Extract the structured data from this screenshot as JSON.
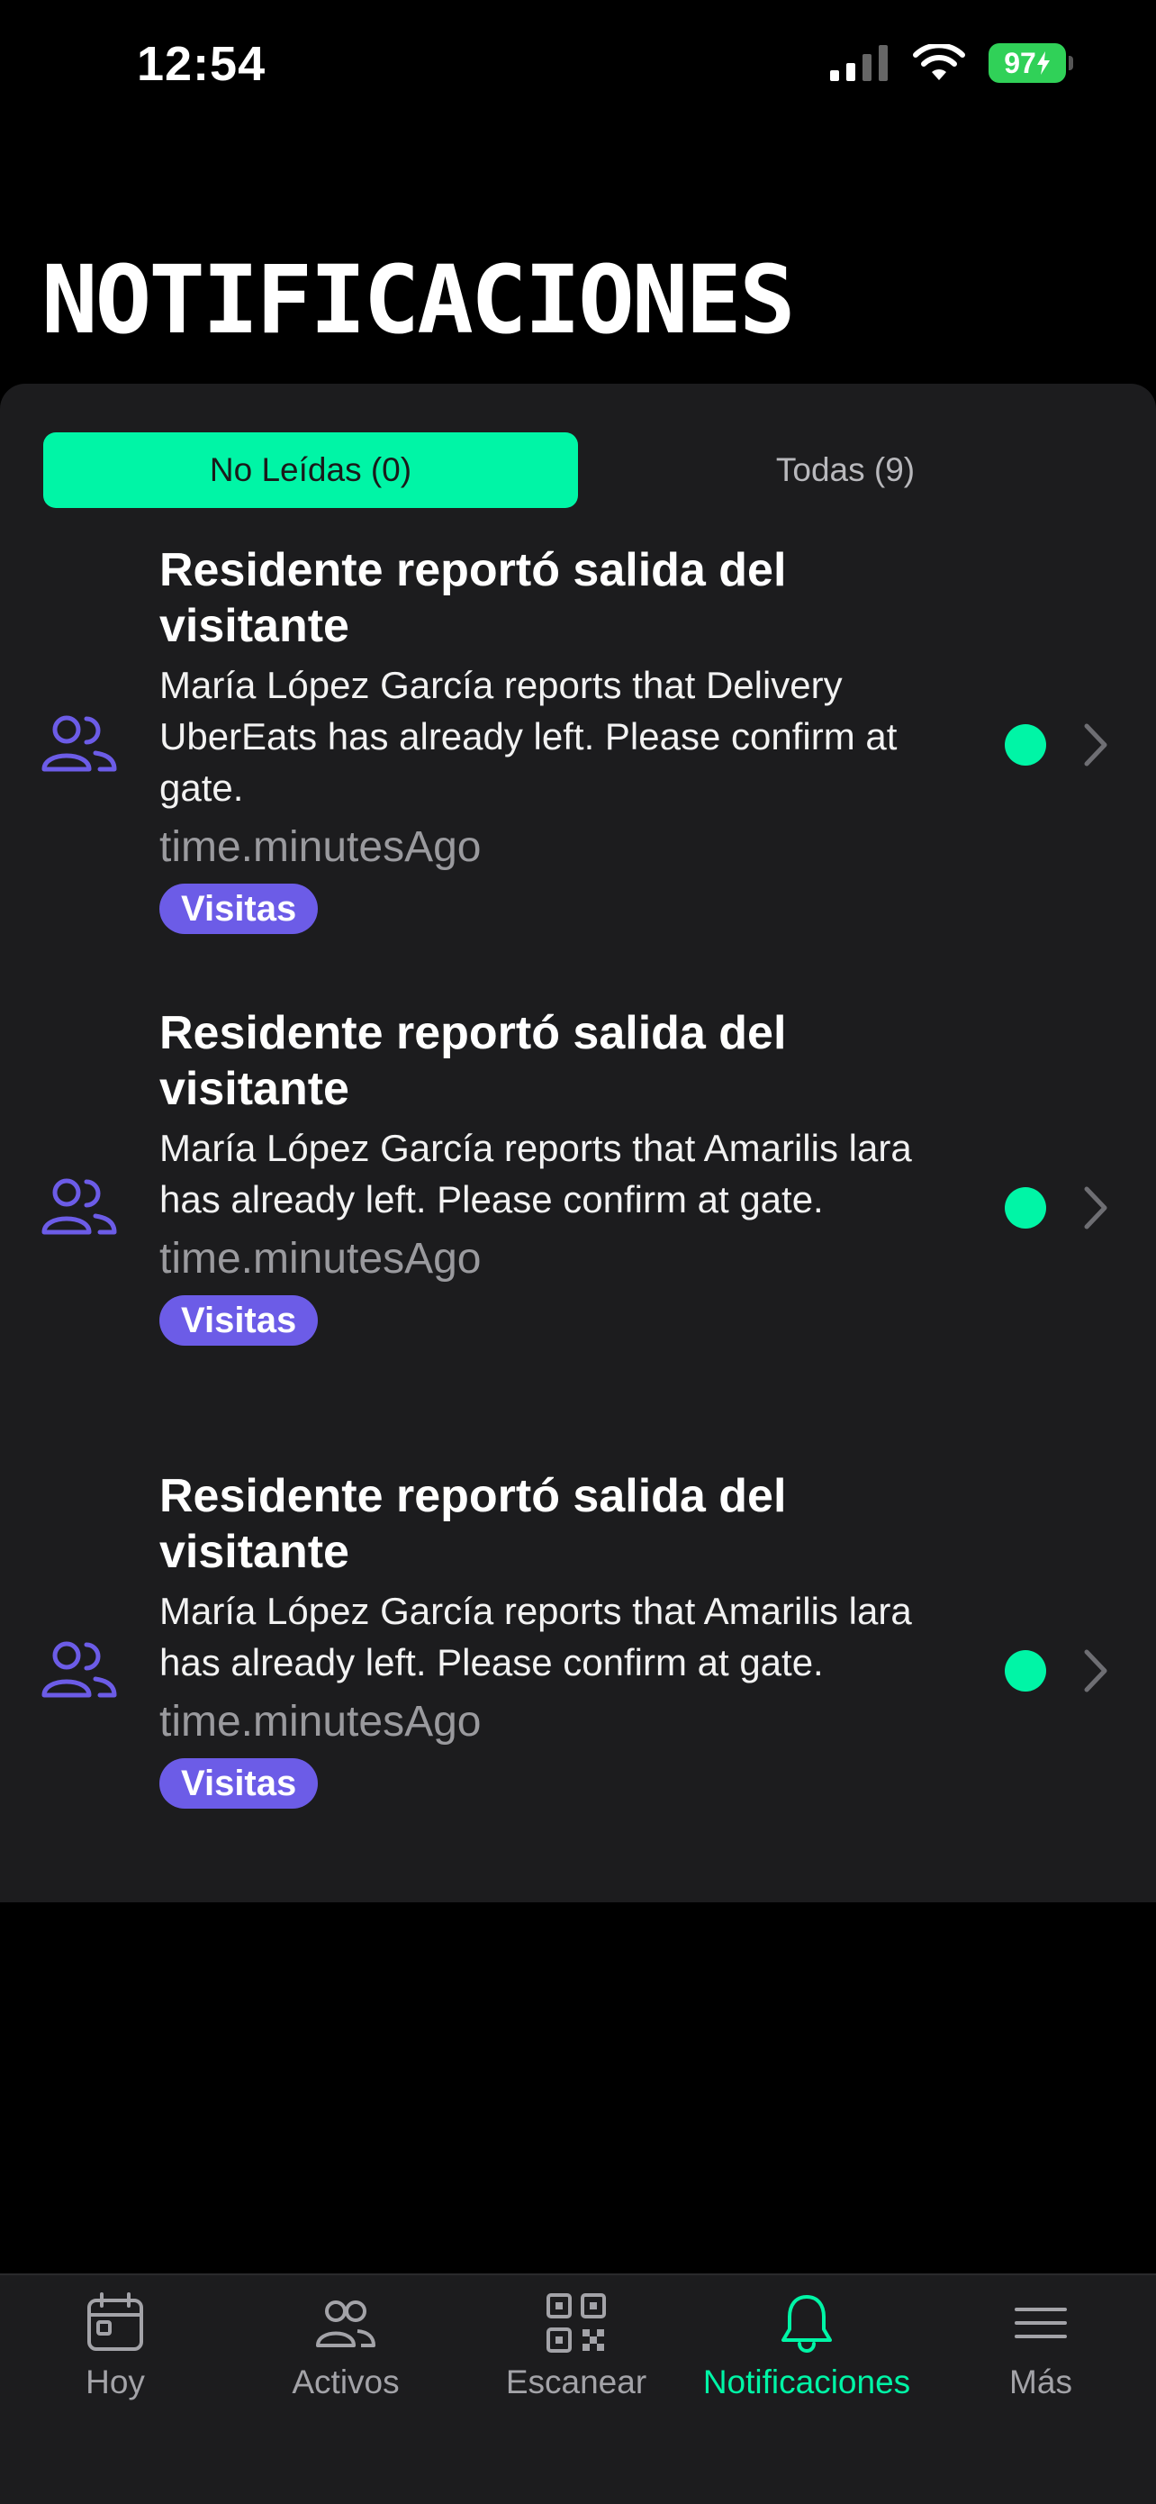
{
  "status_bar": {
    "time": "12:54",
    "battery": "97"
  },
  "page": {
    "title": "Notificaciones"
  },
  "tabs": [
    {
      "label": "No Leídas (0)",
      "active": true
    },
    {
      "label": "Todas (9)",
      "active": false
    }
  ],
  "notifications": [
    {
      "icon": "people-icon",
      "title": "Residente reportó salida del visitante",
      "message": "María López García reports that Delivery UberEats has already left. Please confirm at gate.",
      "time": "time.minutesAgo",
      "tag": "Visitas"
    },
    {
      "icon": "people-icon",
      "title": "Residente reportó salida del visitante",
      "message": "María López García reports that Amarilis lara has already left. Please confirm at gate.",
      "time": "time.minutesAgo",
      "tag": "Visitas"
    },
    {
      "icon": "people-icon",
      "title": "Residente reportó salida del visitante",
      "message": "María López García reports that Amarilis lara has already left. Please confirm at gate.",
      "time": "time.minutesAgo",
      "tag": "Visitas"
    }
  ],
  "tabbar": [
    {
      "label": "Hoy",
      "icon": "calendar-icon",
      "active": false
    },
    {
      "label": "Activos",
      "icon": "people-icon",
      "active": false
    },
    {
      "label": "Escanear",
      "icon": "qr-code-icon",
      "active": false
    },
    {
      "label": "Notificaciones",
      "icon": "bell-icon",
      "active": true
    },
    {
      "label": "Más",
      "icon": "menu-icon",
      "active": false
    }
  ],
  "colors": {
    "accent": "#00f5a6",
    "tag_purple": "#6c5ce7",
    "surface": "#1c1c1e",
    "background": "#000000"
  }
}
